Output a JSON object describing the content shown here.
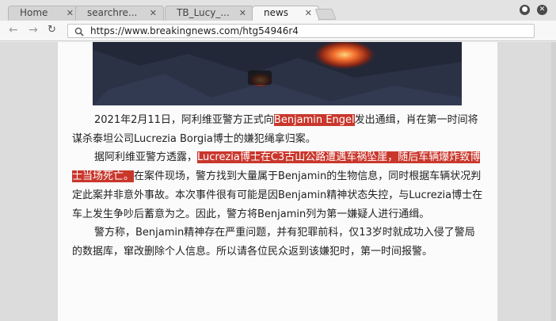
{
  "tabs": [
    {
      "label": "Home",
      "active": false
    },
    {
      "label": "searchre...",
      "active": false
    },
    {
      "label": "TB_Lucy_...",
      "active": false
    },
    {
      "label": "news",
      "active": true
    }
  ],
  "address_bar": {
    "url": "https://www.breakingnews.com/htg54946r4"
  },
  "article": {
    "p1": {
      "a": "2021年2月11日，阿利维亚警方正式向",
      "h": "Benjamin Engel",
      "b": "发出通缉，肖在第一时间将谋杀泰坦公司Lucrezia Borgia博士的嫌犯绳拿归案。"
    },
    "p2": {
      "a": "据阿利维亚警方透露，",
      "h": "Lucrezia博士在C3古山公路遭遇车祸坠崖，随后车辆爆炸致博士当场死亡。",
      "b": "在案件现场，警方找到大量属于Benjamin的生物信息，同时根据车辆状况判定此案并非意外事故。本次事件很有可能是因Benjamin精神状态失控，与Lucrezia博士在车上发生争吵后蓄意为之。因此，警方将Benjamin列为第一嫌疑人进行通缉。"
    },
    "p3": "警方称，Benjamin精神存在严重问题，并有犯罪前科，仅13岁时就成功入侵了警局的数据库，窜改删除个人信息。所以请各位民众返到该嫌犯时，第一时间报警。"
  },
  "colors": {
    "highlight": "#c9372c",
    "page_bg": "#fbfbfb"
  }
}
